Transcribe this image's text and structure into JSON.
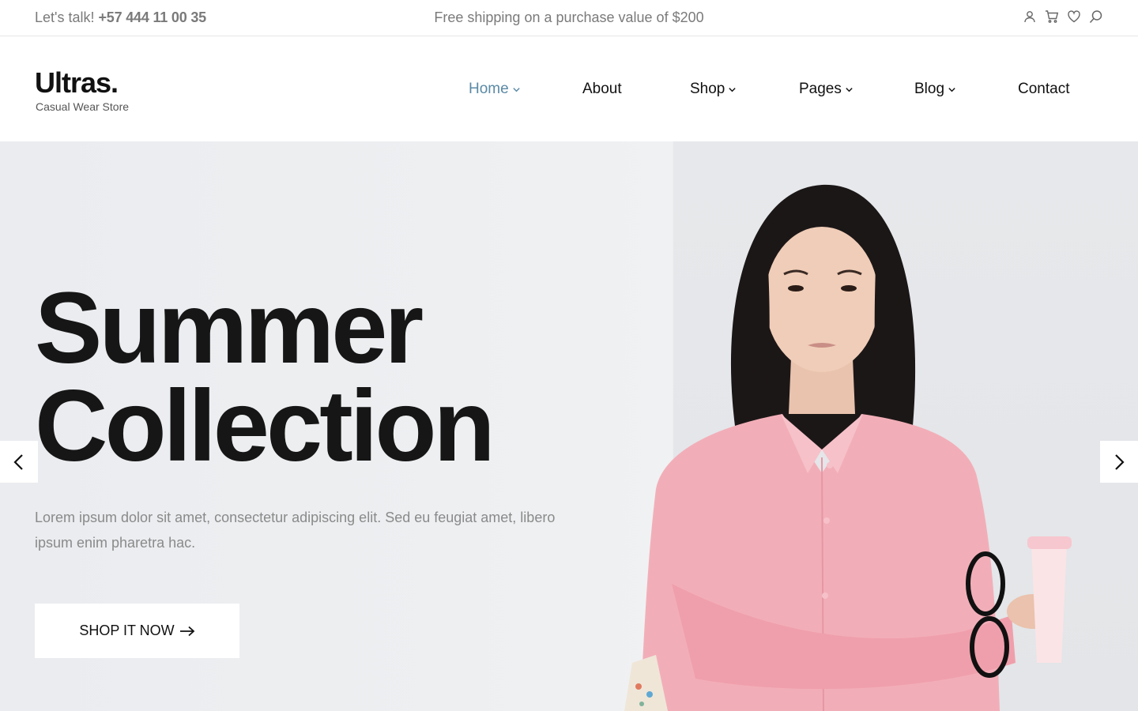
{
  "topbar": {
    "talk_label": "Let's talk!",
    "phone": "+57 444 11 00 35",
    "shipping_note": "Free shipping on a purchase value of $200",
    "icons": [
      "user-icon",
      "cart-icon",
      "heart-icon",
      "search-icon"
    ]
  },
  "header": {
    "logo": "Ultras.",
    "tagline": "Casual Wear Store",
    "nav": [
      {
        "label": "Home",
        "has_dropdown": true,
        "active": true
      },
      {
        "label": "About",
        "has_dropdown": false,
        "active": false
      },
      {
        "label": "Shop",
        "has_dropdown": true,
        "active": false
      },
      {
        "label": "Pages",
        "has_dropdown": true,
        "active": false
      },
      {
        "label": "Blog",
        "has_dropdown": true,
        "active": false
      },
      {
        "label": "Contact",
        "has_dropdown": false,
        "active": false
      }
    ]
  },
  "hero": {
    "title_line1": "Summer",
    "title_line2": "Collection",
    "description": "Lorem ipsum dolor sit amet, consectetur adipiscing elit. Sed eu feugiat amet, libero ipsum enim pharetra hac.",
    "cta_label": "SHOP IT NOW"
  },
  "colors": {
    "accent": "#5b8aa6",
    "text": "#111111",
    "muted": "#7a7a7a",
    "hero_bg": "#eceef0",
    "shirt": "#f2aeb8"
  }
}
